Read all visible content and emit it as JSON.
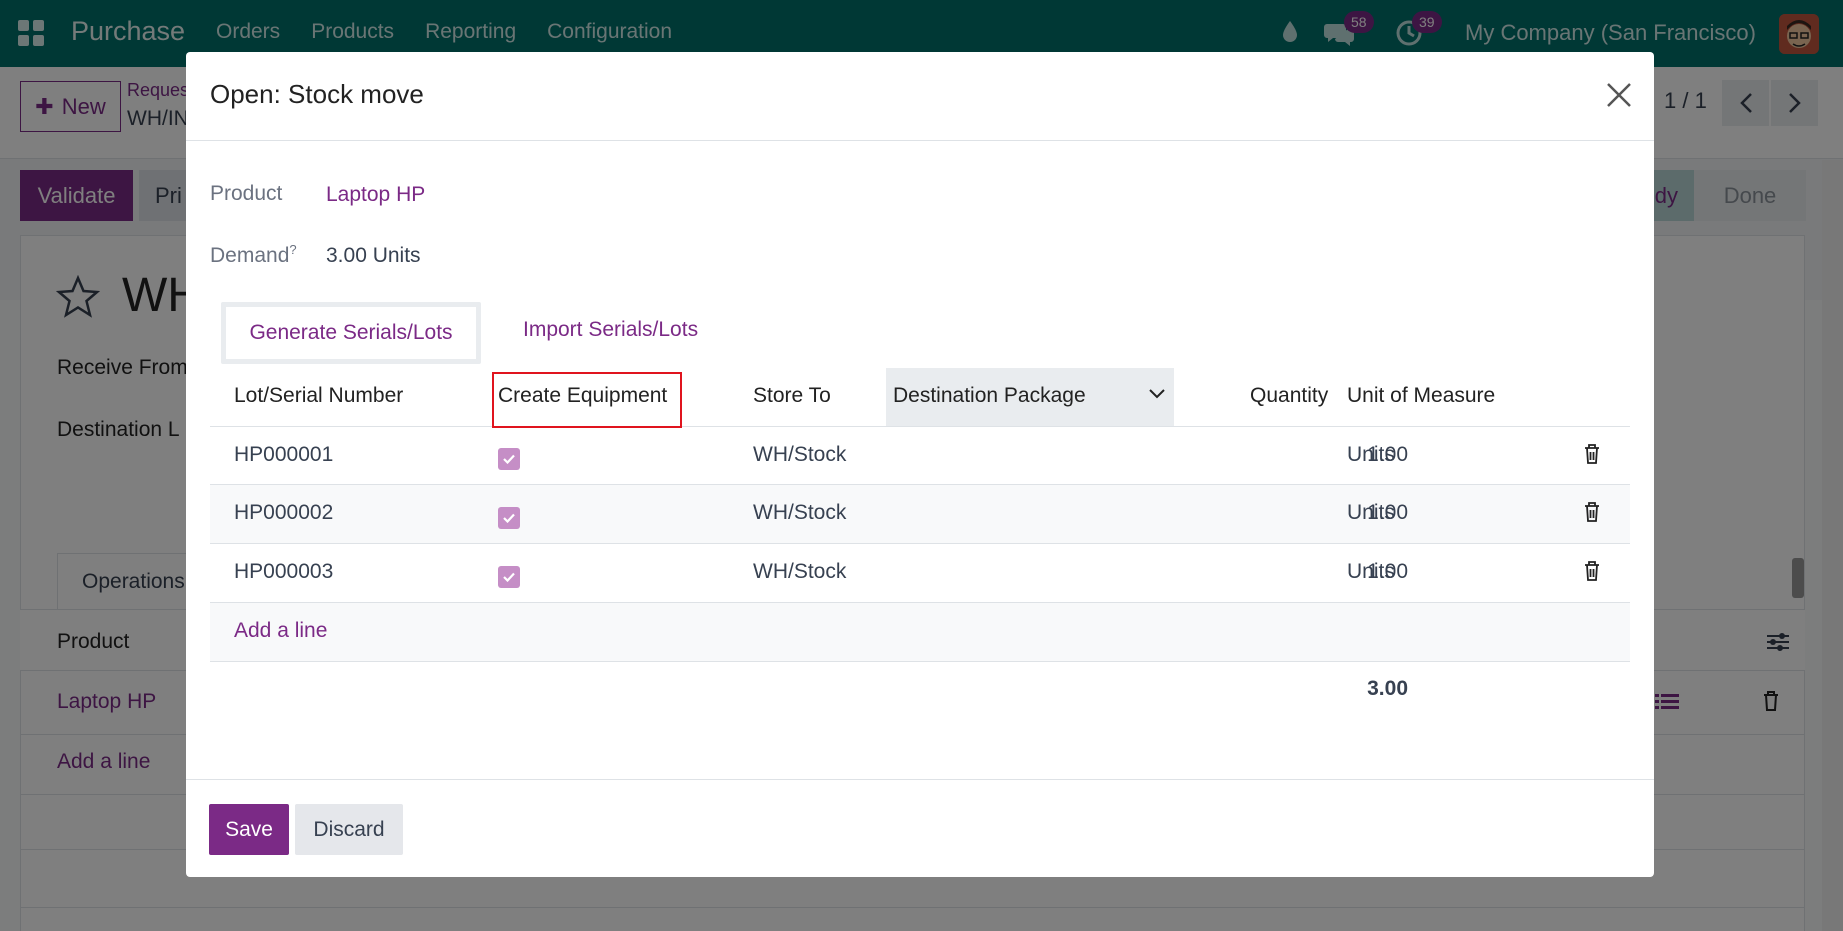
{
  "navbar": {
    "brand": "Purchase",
    "menu": [
      "Orders",
      "Products",
      "Reporting",
      "Configuration"
    ],
    "chat_count": "58",
    "activity_count": "39",
    "company": "My Company (San Francisco)"
  },
  "control_panel": {
    "new_label": "New",
    "breadcrumb_top": "Reques",
    "breadcrumb_sub": "WH/IN",
    "pager": "1 / 1"
  },
  "status_bar": {
    "validate_label": "Validate",
    "print_label": "Pri",
    "stage_ready": "dy",
    "stage_done": "Done"
  },
  "form": {
    "title": "WH",
    "receive_from_label": "Receive From",
    "destination_label": "Destination L",
    "tab_operations": "Operations",
    "list_header_product": "Product",
    "row_product": "Laptop HP",
    "add_line": "Add a line"
  },
  "modal": {
    "title": "Open: Stock move",
    "product_label": "Product",
    "product_value": "Laptop HP",
    "demand_label": "Demand",
    "demand_help": "?",
    "demand_value": "3.00 Units",
    "generate_label": "Generate Serials/Lots",
    "import_label": "Import Serials/Lots",
    "columns": {
      "lot": "Lot/Serial Number",
      "create_equipment": "Create Equipment",
      "store_to": "Store To",
      "destination_package": "Destination Package",
      "quantity": "Quantity",
      "uom": "Unit of Measure"
    },
    "rows": [
      {
        "lot": "HP000001",
        "create_equipment": true,
        "store_to": "WH/Stock",
        "quantity": "1.00",
        "uom": "Units"
      },
      {
        "lot": "HP000002",
        "create_equipment": true,
        "store_to": "WH/Stock",
        "quantity": "1.00",
        "uom": "Units"
      },
      {
        "lot": "HP000003",
        "create_equipment": true,
        "store_to": "WH/Stock",
        "quantity": "1.00",
        "uom": "Units"
      }
    ],
    "add_line": "Add a line",
    "total_quantity": "3.00",
    "save_label": "Save",
    "discard_label": "Discard"
  },
  "colors": {
    "navbar": "#00706b",
    "primary": "#7b2a86",
    "highlight": "#e0141e",
    "checkbox": "#c58ec6"
  }
}
